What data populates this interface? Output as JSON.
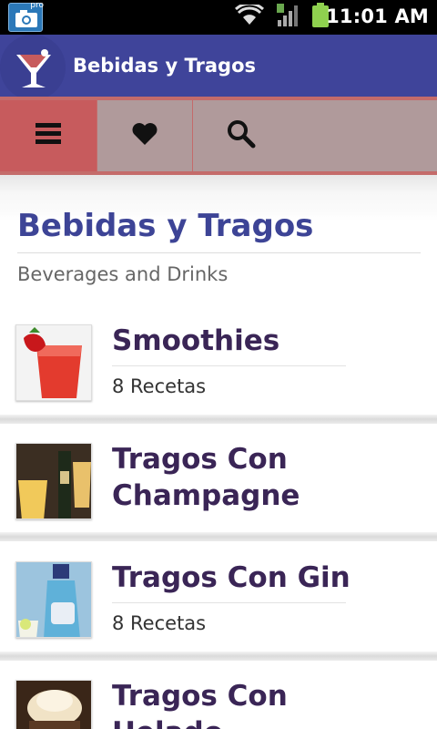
{
  "status_bar": {
    "time": "11:01 AM",
    "app_badge": "pro"
  },
  "action_bar": {
    "title": "Bebidas y Tragos"
  },
  "toolbar": {
    "buttons": [
      "menu-icon",
      "heart-icon",
      "search-icon"
    ]
  },
  "page": {
    "title": "Bebidas y Tragos",
    "subtitle": "Beverages and Drinks"
  },
  "categories": [
    {
      "name": "Smoothies",
      "count": "8 Recetas"
    },
    {
      "name_line1": "Tragos Con",
      "name_line2": "Champagne"
    },
    {
      "name": "Tragos Con Gin",
      "count": "8 Recetas"
    },
    {
      "name_line1": "Tragos Con",
      "name_line2": "Helado"
    }
  ],
  "colors": {
    "action_bar": "#3f449a",
    "toolbar": "#b09a9b",
    "toolbar_active": "#c75b5d",
    "title": "#3d4496",
    "category_text": "#3a2556"
  }
}
